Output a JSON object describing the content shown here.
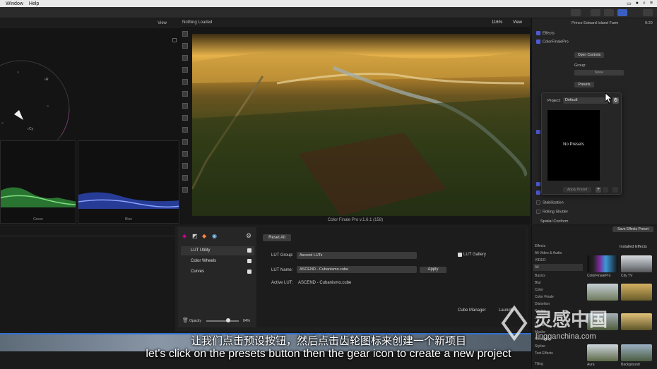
{
  "menubar": {
    "items": [
      "Window",
      "Help"
    ]
  },
  "viewer": {
    "status": "Nothing Loaded",
    "zoom": "116%",
    "view_label": "View",
    "scopes_view_label": "View",
    "plugin_title": "Color Finale Pro v.1.6.1 (158)"
  },
  "scopes": {
    "wave_labels": [
      "Green",
      "Blue"
    ]
  },
  "inspector": {
    "clip_name": "Prince Edward Island Farm",
    "timecode": "0:20",
    "effects_label": "Effects",
    "effect_name": "ColorFinalePro",
    "open_controls": "Open Controls",
    "group_label": "Group:",
    "group_value": "None",
    "presets_button": "Presets",
    "stabilization": "Stabilization",
    "rolling_shutter": "Rolling Shutter",
    "spatial_conform": "Spatial Conform",
    "save_effects_preset": "Save Effects Preset"
  },
  "presets_popup": {
    "project_label": "Project:",
    "project_value": "Default",
    "empty_text": "No Presets",
    "apply_label": "Apply Preset"
  },
  "plugin": {
    "reset_all": "Reset All",
    "modules": [
      {
        "label": "LUT Utility"
      },
      {
        "label": "Color Wheels"
      },
      {
        "label": "Curves"
      }
    ],
    "opacity_label": "Opacity",
    "opacity_value": "84%",
    "lut_group_label": "LUT Group:",
    "lut_group_value": "Ascend LUTs",
    "lut_gallery": "LUT Gallery",
    "lut_name_label": "LUT Name:",
    "lut_name_value": "ASCEND - Cubanismo.cube",
    "apply": "Apply",
    "active_lut_label": "Active LUT:",
    "active_lut_value": "ASCEND - Cubanismo.cube",
    "cube_manager": "Cube Manager",
    "launch": "Launch"
  },
  "browser": {
    "title": "Installed Effects",
    "categories": [
      "Effects",
      "All Video & Audio",
      "VIDEO",
      "All",
      "Basics",
      "Blur",
      "Color",
      "Color Finale",
      "Distortion",
      "Keying",
      "Light",
      "Looks",
      "Masks",
      "Nostalgia",
      "Stylize",
      "Text Effects",
      "Tiling"
    ],
    "thumbs": [
      {
        "name": "ColorFinalePro"
      },
      {
        "name": "City TV"
      },
      {
        "name": ""
      },
      {
        "name": ""
      },
      {
        "name": ""
      },
      {
        "name": ""
      },
      {
        "name": "Aura"
      },
      {
        "name": "Background"
      }
    ]
  },
  "subtitles": {
    "cn": "让我们点击预设按钮，然后点击齿轮图标来创建一个新项目",
    "en": "let's click on the presets button then the gear icon to create a new project"
  },
  "watermark": {
    "cn": "灵感中国",
    "en": "lingganchina.com"
  }
}
